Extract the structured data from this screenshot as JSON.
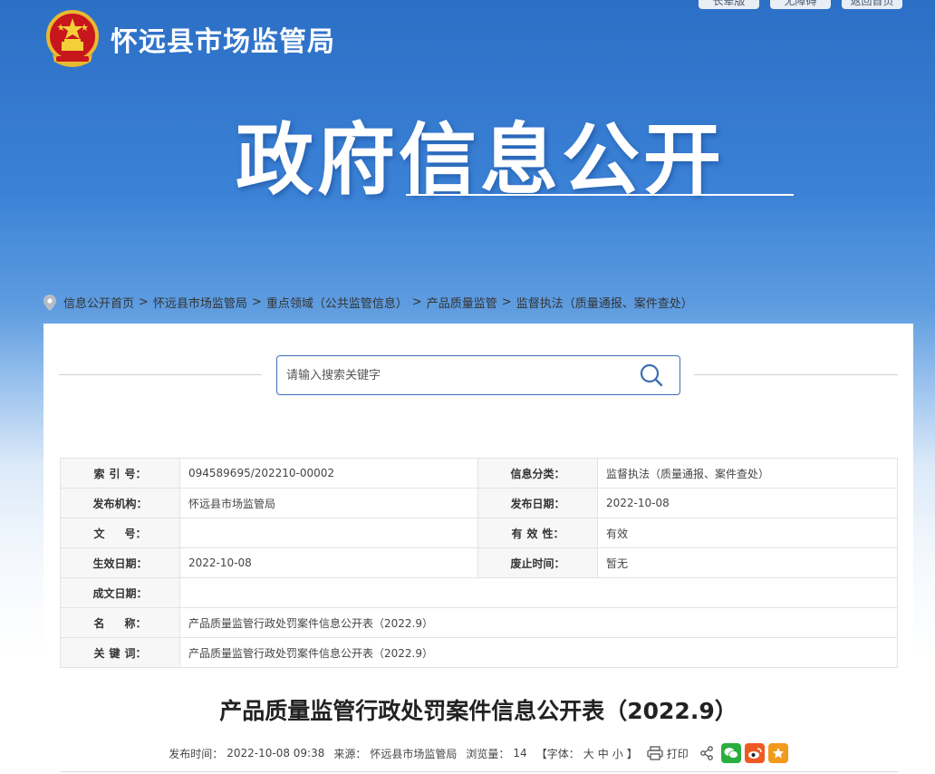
{
  "top_buttons": [
    "长辈版",
    "无障碍",
    "返回首页"
  ],
  "header": {
    "site_name": "怀远县市场监管局",
    "banner_title": "政府信息公开"
  },
  "breadcrumb": [
    "信息公开首页",
    "怀远县市场监管局",
    "重点领域（公共监管信息）",
    "产品质量监管",
    "监督执法（质量通报、案件查处）"
  ],
  "breadcrumb_sep": ">",
  "search": {
    "placeholder": "请输入搜索关键字"
  },
  "info": {
    "index_label": [
      "索",
      "引",
      "号："
    ],
    "index_value": "094589695/202210-00002",
    "category_label": "信息分类：",
    "category_value": "监督执法（质量通报、案件查处）",
    "publisher_label": "发布机构：",
    "publisher_value": "怀远县市场监管局",
    "pub_date_label": "发布日期：",
    "pub_date_value": "2022-10-08",
    "doc_no_label": [
      "文",
      "号："
    ],
    "doc_no_value": "",
    "validity_label": [
      "有",
      "效",
      "性："
    ],
    "validity_value": "有效",
    "effective_label": "生效日期：",
    "effective_value": "2022-10-08",
    "repeal_label": "废止时间：",
    "repeal_value": "暂无",
    "written_label": "成文日期：",
    "written_value": "",
    "name_label": [
      "名",
      "称："
    ],
    "name_value": "产品质量监管行政处罚案件信息公开表（2022.9）",
    "keyword_label": [
      "关",
      "键",
      "词："
    ],
    "keyword_value": "产品质量监管行政处罚案件信息公开表（2022.9）"
  },
  "article": {
    "title": "产品质量监管行政处罚案件信息公开表（2022.9）",
    "pub_time_label": "发布时间：",
    "pub_time": "2022-10-08 09:38",
    "source_label": "来源：",
    "source": "怀远县市场监管局",
    "views_label": "浏览量：",
    "views": "14",
    "font_label": "【字体：",
    "font_large": "大",
    "font_medium": "中",
    "font_small": "小",
    "font_close": "】",
    "print_label": "打印"
  },
  "colors": {
    "banner_blue": "#2c6fc6",
    "search_border": "#3d6fb5",
    "wechat": "#2aae3f",
    "weibo": "#ee5a24",
    "favorite": "#f29a1d"
  }
}
